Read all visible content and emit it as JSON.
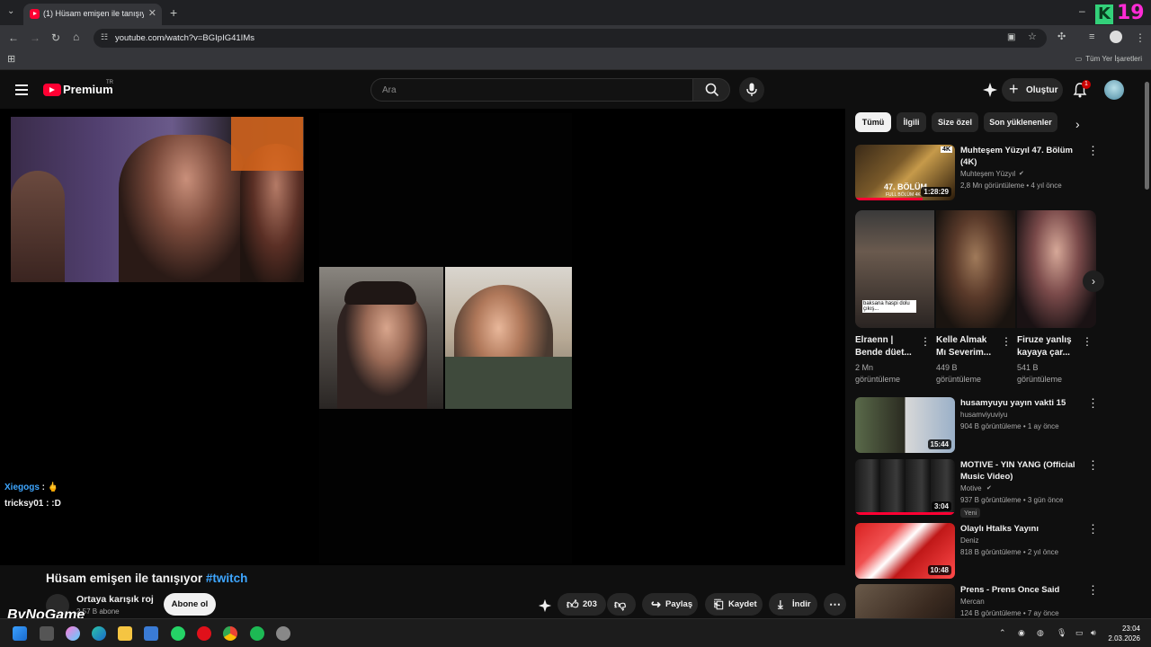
{
  "browser": {
    "tab_title": "(1) Hüsam emişen ile tanışıyor #",
    "url": "youtube.com/watch?v=BGIpIG41IMs",
    "bookmarks_all": "Tüm Yer İşaretleri",
    "overlay_badge": "19",
    "overlay_k": "K"
  },
  "header": {
    "logo": "Premium",
    "region": "TR",
    "search_placeholder": "Ara",
    "create_label": "Oluştur",
    "notif_count": "1"
  },
  "chat": [
    {
      "user": "Xiegogs",
      "sep": " : ",
      "msg": "🖕"
    },
    {
      "user": "tricksy01",
      "sep": " : ",
      "msg": ":D"
    }
  ],
  "video": {
    "title": "Hüsam emişen ile tanışıyor ",
    "hashtag": "#twitch",
    "channel": "Ortaya karışık roj",
    "subs": "2,57 B abone",
    "subscribe": "Abone ol",
    "likes": "203",
    "share": "Paylaş",
    "save": "Kaydet",
    "download": "İndir",
    "watermark": "ByNoGame"
  },
  "chips": [
    "Tümü",
    "İlgili",
    "Size özel",
    "Son yüklenenler"
  ],
  "recs_top": {
    "title": "Muhteşem Yüzyıl 47. Bölüm (4K)",
    "channel": "Muhteşem Yüzyıl",
    "meta": "2,8 Mn görüntüleme • 4 yıl önce",
    "duration": "1:28:29",
    "thumb_text": "47. BÖLÜM",
    "thumb_sub": "FULL BÖLÜM 4K",
    "thumb_4k": "4K"
  },
  "shorts": [
    {
      "title1": "Elraenn |",
      "title2": "Bende düet...",
      "views1": "2 Mn",
      "views2": "görüntüleme",
      "caption": "baksana haspi dolu çıkış..."
    },
    {
      "title1": "Kelle Almak",
      "title2": "Mı Severim...",
      "views1": "449 B",
      "views2": "görüntüleme"
    },
    {
      "title1": "Firuze yanlış",
      "title2": "kayaya çar...",
      "views1": "541 B",
      "views2": "görüntüleme"
    }
  ],
  "recs": [
    {
      "title": "husamyuyu yayın vakti 15",
      "channel": "husamviyuviyu",
      "meta": "904 B görüntüleme • 1 ay önce",
      "duration": "15:44"
    },
    {
      "title": "MOTIVE - YIN YANG (Official Music Video)",
      "channel": "Motive",
      "meta": "937 B görüntüleme • 3 gün önce",
      "duration": "3:04",
      "badge": "Yeni"
    },
    {
      "title": "Olaylı Htalks Yayını",
      "channel": "Deniz",
      "meta": "818 B görüntüleme • 2 yıl önce",
      "duration": "10:48"
    },
    {
      "title": "Prens - Prens Once Said",
      "channel": "Mercan",
      "meta": "124 B görüntüleme • 7 ay önce"
    }
  ],
  "taskbar": {
    "time": "23:04",
    "date": "2.03.2026"
  },
  "colors": {
    "bg": "#0f0f0f",
    "accent": "#ff0033",
    "link": "#3ea6ff"
  }
}
